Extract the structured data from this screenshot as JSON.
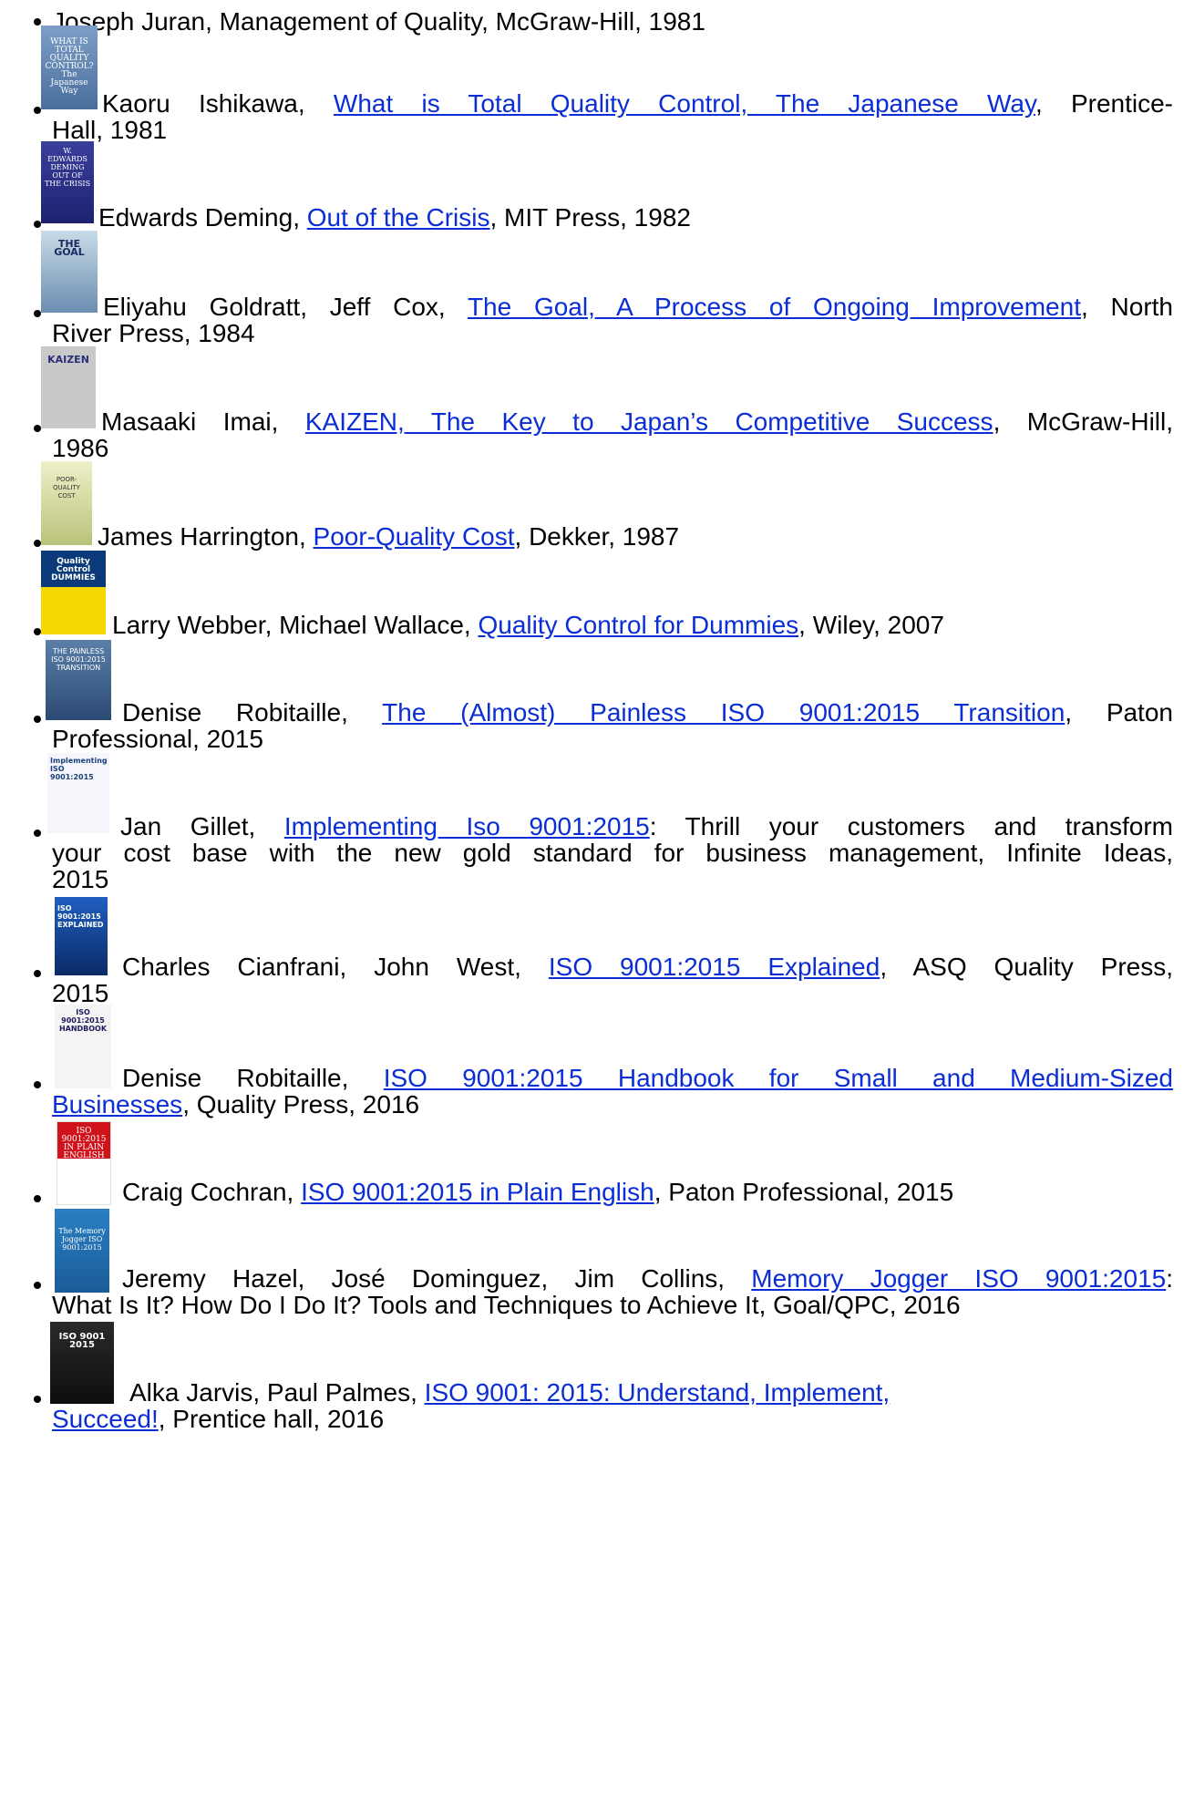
{
  "books": [
    {
      "text": "Joseph Juran, Management of Quality, McGraw-Hill, 1981"
    },
    {
      "pre": "Kaoru Ishikawa, ",
      "link": "What is Total Quality Control, The Japanese Way",
      "post": ", Prentice-",
      "line2": "Hall, 1981",
      "cover": "WHAT IS TOTAL QUALITY CONTROL? The Japanese Way"
    },
    {
      "pre": "Edwards Deming, ",
      "link": "Out of the Crisis",
      "post": ", MIT Press, 1982",
      "cover": "W. EDWARDS DEMING OUT OF THE CRISIS"
    },
    {
      "pre": "Eliyahu Goldratt, Jeff Cox, ",
      "link": "The Goal, A Process of Ongoing Improvement",
      "post": ", North",
      "line2": "River Press, 1984",
      "cover": "THE GOAL"
    },
    {
      "pre": "Masaaki Imai, ",
      "link": "KAIZEN, The Key to Japan’s Competitive Success",
      "post": ", McGraw-Hill,",
      "line2": "1986",
      "cover": "KAIZEN"
    },
    {
      "pre": "James Harrington, ",
      "link": "Poor-Quality Cost",
      "post": ", Dekker, 1987",
      "cover": "POOR-QUALITY COST"
    },
    {
      "pre": "Larry Webber, Michael Wallace, ",
      "link": "Quality Control for Dummies",
      "post": ", Wiley, 2007",
      "cover": "Quality Control DUMMIES"
    },
    {
      "pre": "Denise Robitaille, ",
      "link": "The (Almost) Painless ISO 9001:2015 Transition",
      "post": ", Paton",
      "line2": "Professional, 2015",
      "cover": "THE PAINLESS ISO 9001:2015 TRANSITION"
    },
    {
      "pre": "Jan Gillet, ",
      "link": "Implementing Iso 9001:2015",
      "post": ": Thrill your customers and transform",
      "line2": "your cost base with the new gold standard for business management, Infinite Ideas,",
      "line3": "2015",
      "cover": "Implementing ISO 9001:2015"
    },
    {
      "pre": "Charles Cianfrani, John West, ",
      "link": "ISO 9001:2015 Explained",
      "post": ", ASQ Quality Press,",
      "line2": "2015",
      "cover": "ISO 9001:2015 EXPLAINED"
    },
    {
      "pre": "Denise Robitaille, ",
      "link": "ISO 9001:2015 Handbook for Small and Medium-Sized",
      "post": "",
      "line2link": "Businesses",
      "line2": ", Quality Press, 2016",
      "cover": "ISO 9001:2015 HANDBOOK"
    },
    {
      "pre": "Craig Cochran, ",
      "link": "ISO 9001:2015 in Plain English",
      "post": ", Paton Professional, 2015",
      "cover": "ISO 9001:2015 IN PLAIN ENGLISH"
    },
    {
      "pre": "Jeremy Hazel, José Dominguez, Jim Collins, ",
      "link": "Memory Jogger ISO 9001:2015",
      "post": ":",
      "line2": "What Is It? How Do I Do It? Tools and Techniques to Achieve It, Goal/QPC, 2016",
      "cover": "The Memory Jogger ISO 9001:2015"
    },
    {
      "pre": "Alka Jarvis, Paul Palmes, ",
      "link": "ISO 9001: 2015: Understand, Implement,",
      "post": "",
      "line2link": "Succeed!",
      "line2": ", Prentice hall, 2016",
      "cover": "ISO 9001 2015"
    }
  ]
}
